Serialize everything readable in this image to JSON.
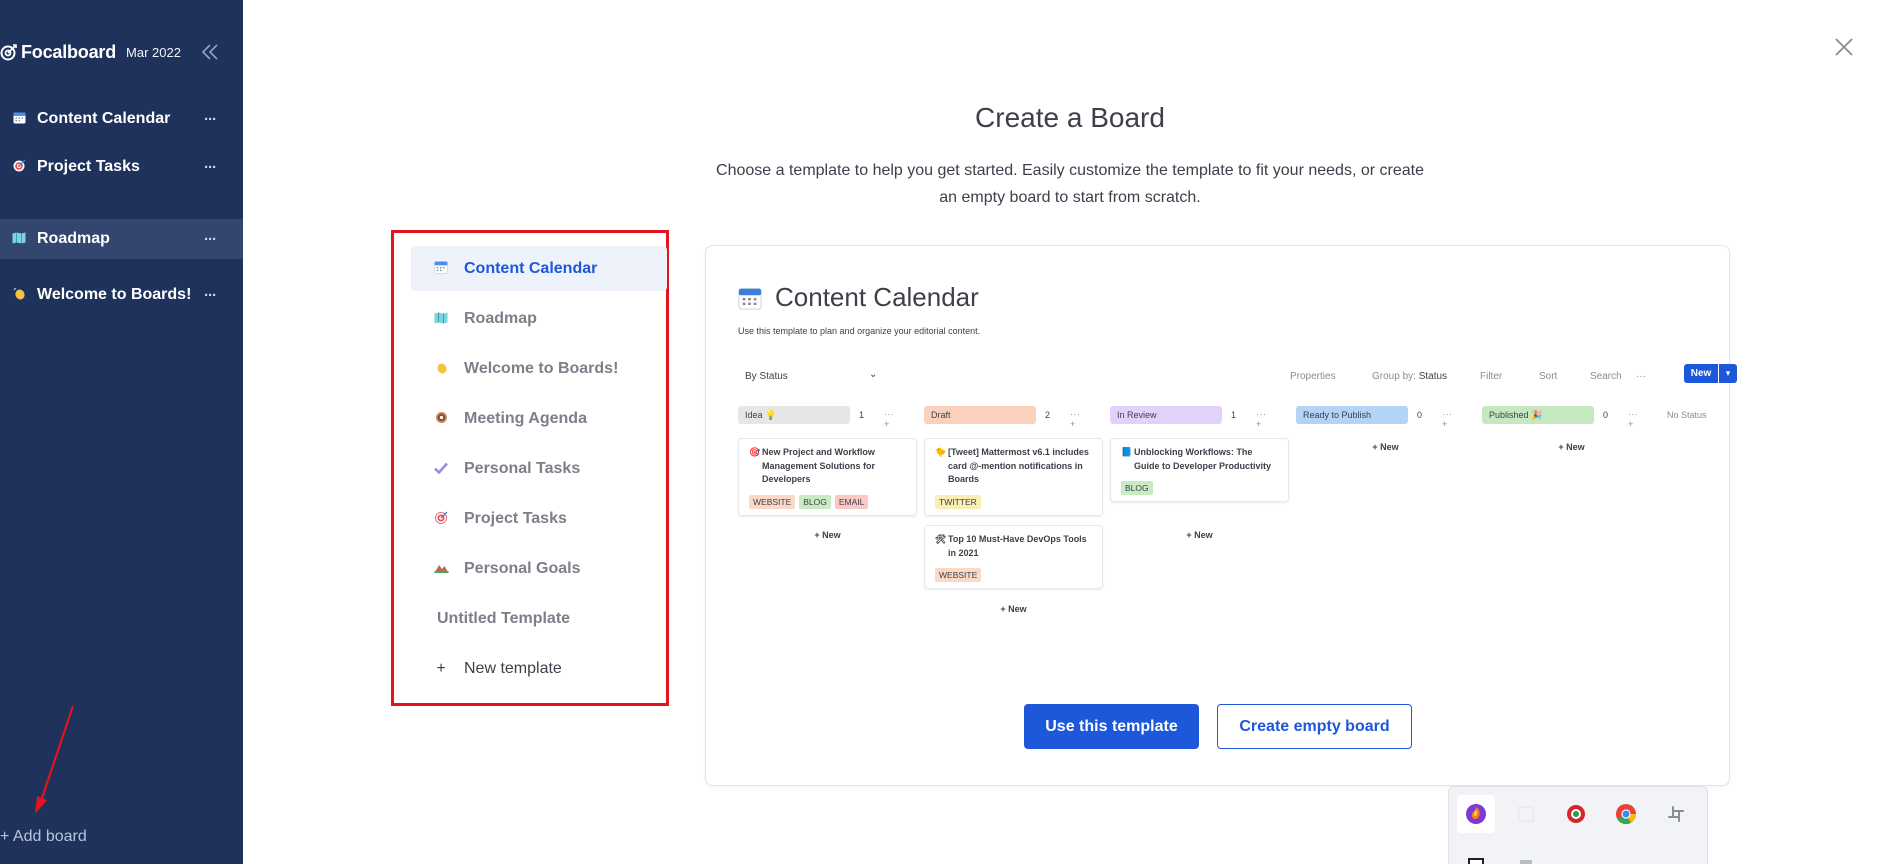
{
  "sidebar": {
    "logo_text": "Focalboard",
    "version": "Mar 2022",
    "collapse_icon": "double-chevron-left-icon",
    "boards": [
      {
        "icon": "calendar-icon",
        "glyph": "📅",
        "label": "Content Calendar",
        "dots": "···",
        "active": false
      },
      {
        "icon": "target-icon",
        "glyph": "🎯",
        "label": "Project Tasks",
        "dots": "···",
        "active": false
      },
      {
        "icon": "map-icon",
        "glyph": "🗺",
        "label": "Roadmap",
        "dots": "···",
        "active": true
      },
      {
        "icon": "waving-hand-icon",
        "glyph": "👋",
        "label": "Welcome to Boards!",
        "dots": "···",
        "active": false
      }
    ],
    "add_board": "+ Add board"
  },
  "dialog": {
    "title": "Create a Board",
    "subtitle": "Choose a template to help you get started. Easily customize the template to fit your needs, or create an empty board to start from scratch.",
    "templates": [
      {
        "icon": "calendar-icon",
        "glyph": "📅",
        "label": "Content Calendar",
        "active": true
      },
      {
        "icon": "map-icon",
        "glyph": "🗺",
        "label": "Roadmap"
      },
      {
        "icon": "waving-hand-icon",
        "glyph": "👋",
        "label": "Welcome to Boards!"
      },
      {
        "icon": "donut-icon",
        "glyph": "🍩",
        "label": "Meeting Agenda"
      },
      {
        "icon": "checkmark-icon",
        "glyph": "✔",
        "label": "Personal Tasks"
      },
      {
        "icon": "target-icon",
        "glyph": "🎯",
        "label": "Project Tasks"
      },
      {
        "icon": "mountain-icon",
        "glyph": "⛰",
        "label": "Personal Goals"
      },
      {
        "icon": "",
        "glyph": "",
        "label": "Untitled Template"
      },
      {
        "icon": "plus-icon",
        "glyph": "+",
        "label": "New template"
      }
    ],
    "use_template_button": "Use this template",
    "create_empty_button": "Create empty board",
    "close_icon": "close-icon"
  },
  "preview": {
    "title": "Content Calendar",
    "description": "Use this template to plan and organize your editorial content.",
    "toolbar": {
      "view": "By Status",
      "properties": "Properties",
      "group_by_label": "Group by:",
      "group_by_value": "Status",
      "filter": "Filter",
      "sort": "Sort",
      "search": "Search",
      "more": "···",
      "new": "New"
    },
    "columns": [
      {
        "label": "Idea 💡",
        "count": "1",
        "color": "#e6e6e6"
      },
      {
        "label": "Draft",
        "count": "2",
        "color": "#fbd1be"
      },
      {
        "label": "In Review",
        "count": "1",
        "color": "#e2d1fa"
      },
      {
        "label": "Ready to Publish",
        "count": "0",
        "color": "#b3d4f7"
      },
      {
        "label": "Published 🎉",
        "count": "0",
        "color": "#c5e8c0"
      }
    ],
    "column_ops": "···  +",
    "no_status": "No Status",
    "add_new": "+ New",
    "cards": [
      {
        "emoji": "🎯",
        "title": "New Project and Workflow Management Solutions for Developers",
        "tags": [
          {
            "text": "WEBSITE",
            "color": "#fbd9c6"
          },
          {
            "text": "BLOG",
            "color": "#c8ebc4"
          },
          {
            "text": "EMAIL",
            "color": "#fbc9c1"
          }
        ]
      },
      {
        "emoji": "🐤",
        "title": "[Tweet] Mattermost v6.1 includes card @-mention notifications in Boards",
        "tags": [
          {
            "text": "TWITTER",
            "color": "#f9eeb4"
          }
        ]
      },
      {
        "emoji": "🛠",
        "title": "Top 10 Must-Have DevOps Tools in 2021",
        "tags": [
          {
            "text": "WEBSITE",
            "color": "#fbd9c6"
          }
        ]
      },
      {
        "emoji": "📘",
        "title": "Unblocking Workflows: The Guide to Developer Productivity",
        "tags": [
          {
            "text": "BLOG",
            "color": "#c8ebc4"
          }
        ]
      }
    ]
  },
  "tray": {
    "icons": [
      "firefox-icon",
      "blank-icon",
      "antivirus-icon",
      "chrome-icon",
      "slack-icon",
      "notion-icon",
      "app-icon"
    ]
  },
  "colors": {
    "sidebar_bg": "#1e325c",
    "accent": "#1c58d9",
    "annotation_red": "#e2141d"
  }
}
